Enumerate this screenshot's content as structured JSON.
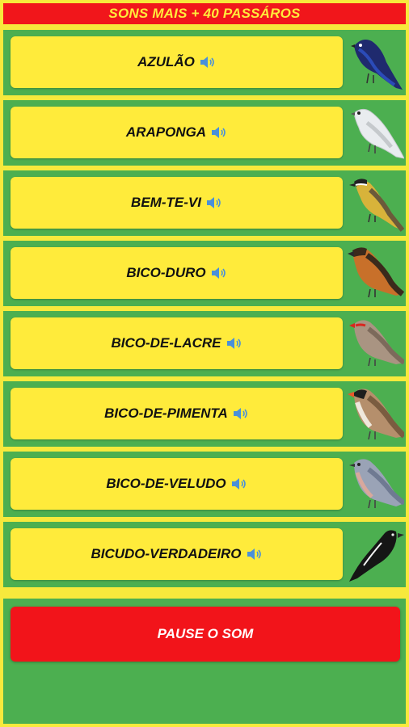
{
  "header": {
    "title": "SONS MAIS + 40 PASSÁROS"
  },
  "birds": [
    {
      "label": "AZULÃO",
      "icon": "bird-blue-icon"
    },
    {
      "label": "ARAPONGA",
      "icon": "bird-white-icon"
    },
    {
      "label": "BEM-TE-VI",
      "icon": "bird-kiskadee-icon"
    },
    {
      "label": "BICO-DURO",
      "icon": "bird-orange-icon"
    },
    {
      "label": "BICO-DE-LACRE",
      "icon": "bird-waxbill-icon"
    },
    {
      "label": "BICO-DE-PIMENTA",
      "icon": "bird-saltator-icon"
    },
    {
      "label": "BICO-DE-VELUDO",
      "icon": "bird-grey-icon"
    },
    {
      "label": "BICUDO-VERDADEIRO",
      "icon": "bird-black-icon"
    }
  ],
  "pause": {
    "label": "PAUSE O SOM"
  },
  "colors": {
    "header_bg": "#f1161b",
    "row_bg": "#4caf50",
    "button_bg": "#ffeb3b",
    "pause_bg": "#f2141a"
  }
}
